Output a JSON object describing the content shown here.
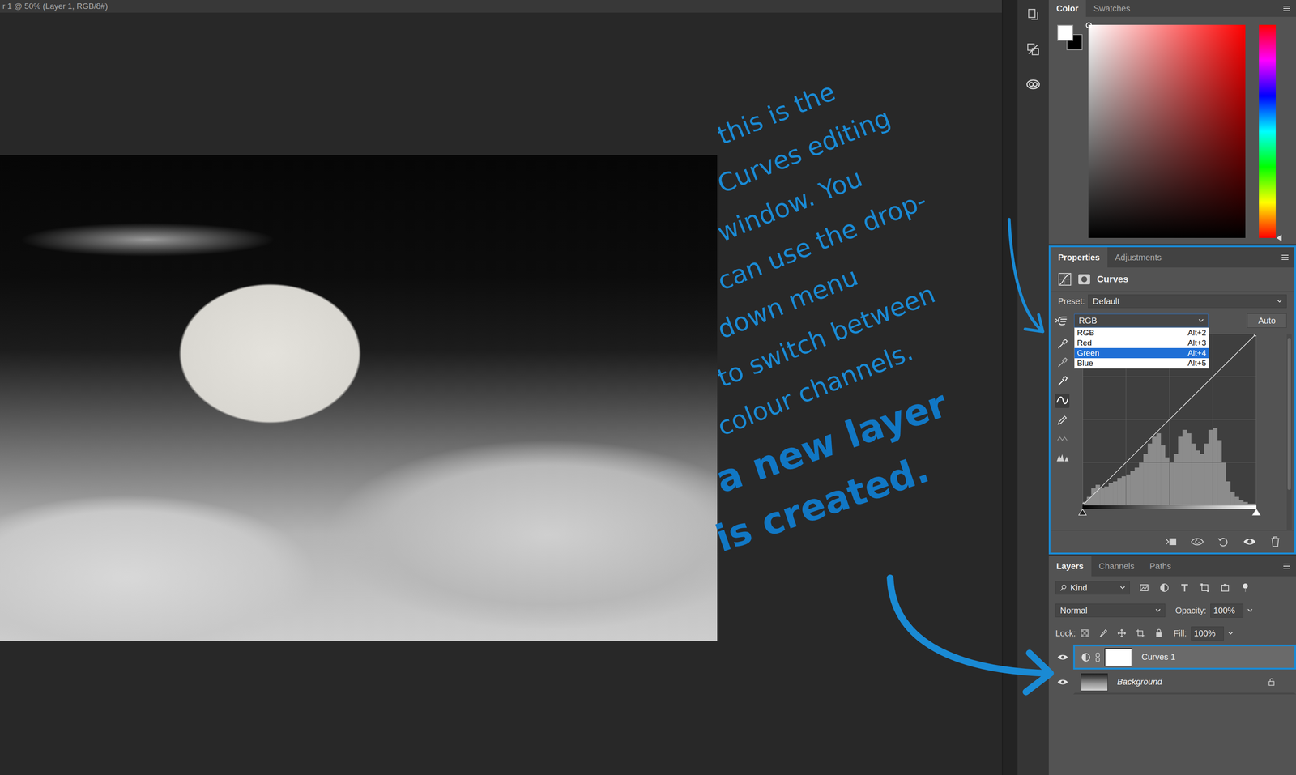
{
  "document": {
    "tab_title": "r 1 @ 50% (Layer 1, RGB/8#)"
  },
  "annotations": {
    "notes": [
      {
        "kind": "thin",
        "lines": [
          "this is the",
          "Curves editing",
          "window. You",
          "can use the drop-",
          "down menu",
          "to switch between",
          "colour channels."
        ]
      },
      {
        "kind": "bold",
        "lines": [
          "a new layer",
          "is created."
        ]
      }
    ]
  },
  "color_panel": {
    "tabs": [
      {
        "label": "Color",
        "selected": true
      },
      {
        "label": "Swatches",
        "selected": false
      }
    ],
    "foreground": "#ffffff",
    "background": "#000000",
    "hue": "#ff0000"
  },
  "properties": {
    "highlighted": true,
    "tabs": [
      {
        "label": "Properties",
        "selected": true
      },
      {
        "label": "Adjustments",
        "selected": false
      }
    ],
    "title": "Curves",
    "preset_label": "Preset:",
    "preset": "Default",
    "channel": "RGB",
    "channel_menu_open": true,
    "channel_options": [
      {
        "label": "RGB",
        "shortcut": "Alt+2",
        "selected": false
      },
      {
        "label": "Red",
        "shortcut": "Alt+3",
        "selected": false
      },
      {
        "label": "Green",
        "shortcut": "Alt+4",
        "selected": true
      },
      {
        "label": "Blue",
        "shortcut": "Alt+5",
        "selected": false
      }
    ],
    "auto_button": "Auto",
    "histogram": [
      0.02,
      0.05,
      0.1,
      0.12,
      0.1,
      0.11,
      0.13,
      0.14,
      0.16,
      0.17,
      0.18,
      0.2,
      0.22,
      0.25,
      0.3,
      0.36,
      0.4,
      0.42,
      0.35,
      0.28,
      0.25,
      0.3,
      0.4,
      0.44,
      0.42,
      0.36,
      0.32,
      0.3,
      0.36,
      0.44,
      0.45,
      0.38,
      0.25,
      0.14,
      0.08,
      0.05,
      0.03,
      0.02,
      0.01,
      0.01
    ],
    "curve": [
      [
        0,
        0
      ],
      [
        1,
        1
      ]
    ]
  },
  "layers": {
    "tabs": [
      {
        "label": "Layers",
        "selected": true
      },
      {
        "label": "Channels",
        "selected": false
      },
      {
        "label": "Paths",
        "selected": false
      }
    ],
    "filter": "Kind",
    "blend_mode": "Normal",
    "opacity": {
      "label": "Opacity:",
      "value": "100%"
    },
    "lock_label": "Lock:",
    "fill": {
      "label": "Fill:",
      "value": "100%"
    },
    "items": [
      {
        "name": "Curves 1",
        "kind": "adjustment",
        "visible": true,
        "selected": true,
        "locked": false,
        "highlighted": true
      },
      {
        "name": "Background",
        "kind": "background",
        "visible": true,
        "selected": false,
        "locked": true,
        "highlighted": false
      }
    ]
  }
}
